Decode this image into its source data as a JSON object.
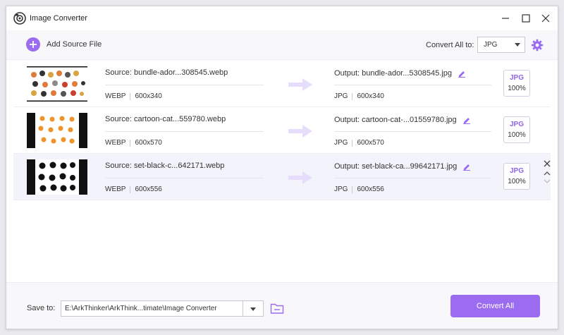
{
  "window": {
    "title": "Image Converter"
  },
  "toolbar": {
    "add_label": "Add Source File",
    "convert_all_to_label": "Convert All to:",
    "format_value": "JPG"
  },
  "files": [
    {
      "source": "Source: bundle-ador...308545.webp",
      "source_format": "WEBP",
      "source_size": "600x340",
      "output": "Output: bundle-ador...5308545.jpg",
      "output_format": "JPG",
      "output_size": "600x340",
      "badge_format": "JPG",
      "badge_percent": "100%"
    },
    {
      "source": "Source: cartoon-cat...559780.webp",
      "source_format": "WEBP",
      "source_size": "600x570",
      "output": "Output: cartoon-cat-...01559780.jpg",
      "output_format": "JPG",
      "output_size": "600x570",
      "badge_format": "JPG",
      "badge_percent": "100%"
    },
    {
      "source": "Source: set-black-c...642171.webp",
      "source_format": "WEBP",
      "source_size": "600x556",
      "output": "Output: set-black-ca...99642171.jpg",
      "output_format": "JPG",
      "output_size": "600x556",
      "badge_format": "JPG",
      "badge_percent": "100%"
    }
  ],
  "bottom": {
    "save_to_label": "Save to:",
    "save_path": "E:\\ArkThinker\\ArkThink...timate\\Image Converter",
    "convert_all_label": "Convert All"
  },
  "colors": {
    "accent": "#9b6cf0",
    "badge_text": "#8d63e8",
    "arrow": "#e6dcfb"
  },
  "icons": {
    "app": "camera-logo-icon",
    "add": "plus-circle-icon",
    "settings": "gear-icon",
    "edit": "pencil-icon",
    "arrow": "arrow-right-icon",
    "folder": "folder-icon"
  }
}
